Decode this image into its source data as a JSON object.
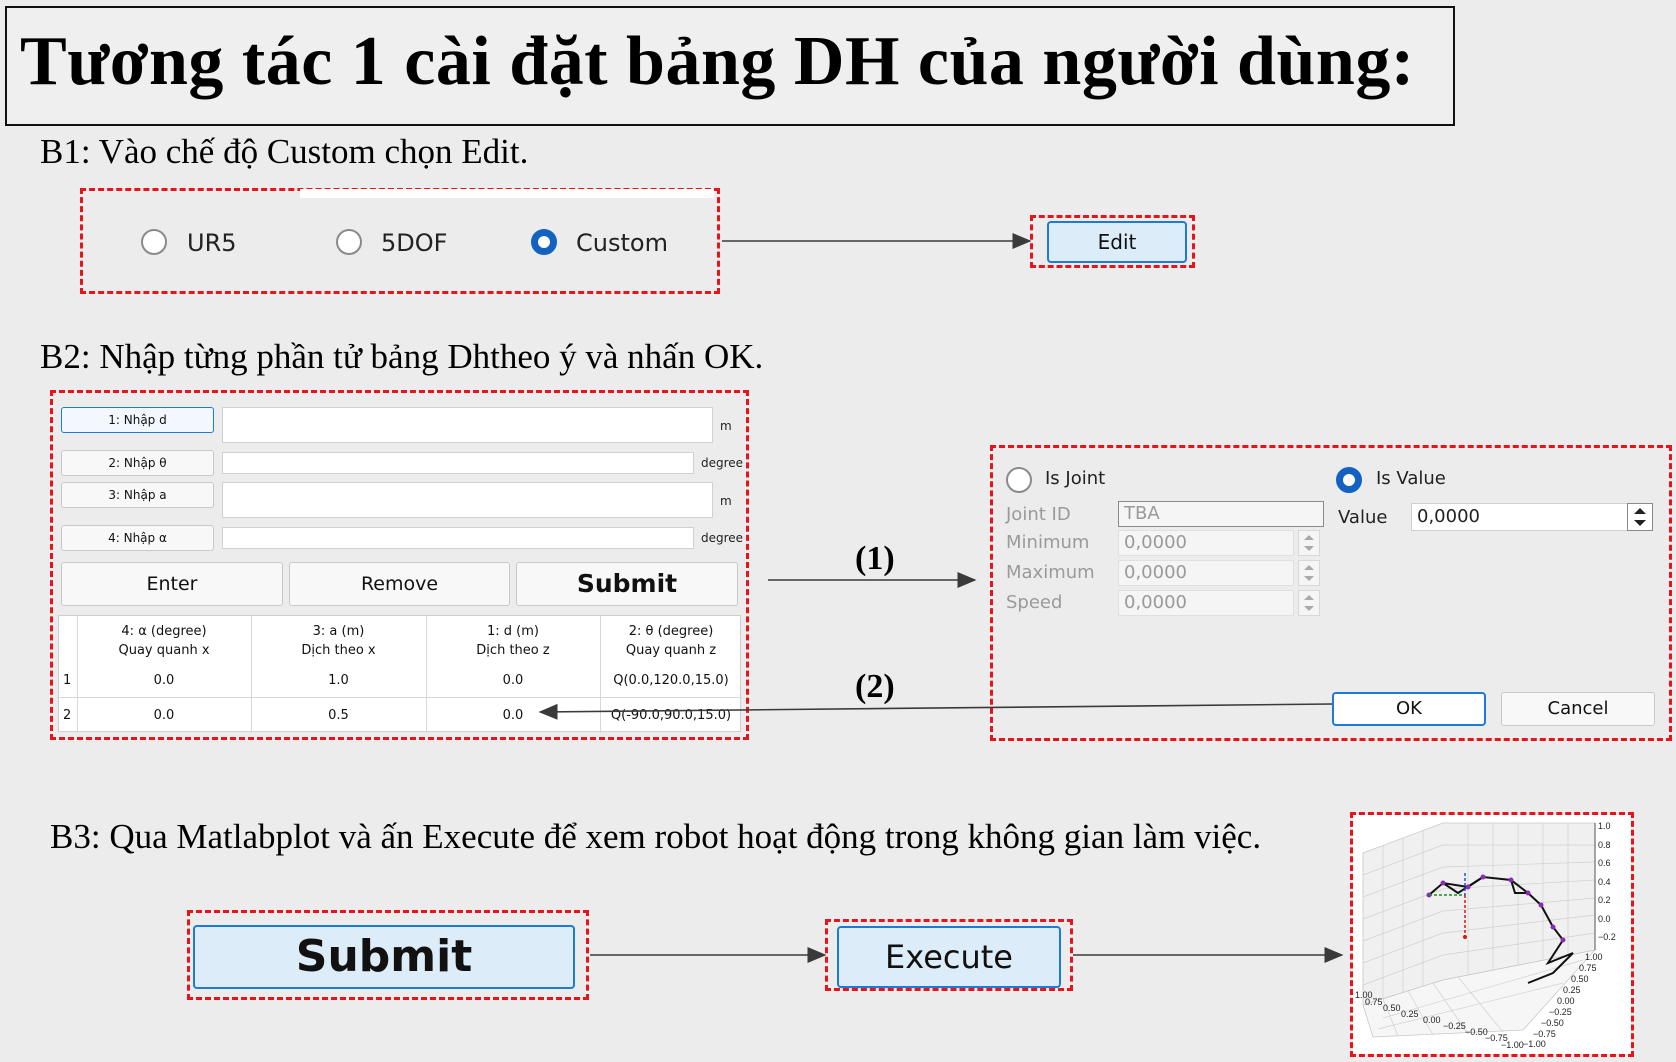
{
  "title": "Tương tác 1 cài đặt bảng DH của người dùng:",
  "steps": {
    "b1": "B1: Vào chế độ Custom chọn Edit.",
    "b2": "B2: Nhập từng phần tử bảng Dhtheo ý và nhấn OK.",
    "b3": "B3: Qua Matlabplot và ấn Execute để xem robot hoạt động trong không gian làm việc."
  },
  "mode_selector": {
    "options": [
      "UR5",
      "5DOF",
      "Custom"
    ],
    "selected": "Custom"
  },
  "edit_button": "Edit",
  "dh_form": {
    "fields": [
      {
        "label": "1: Nhập d",
        "unit": "m"
      },
      {
        "label": "2: Nhập θ",
        "unit": "degree"
      },
      {
        "label": "3: Nhập a",
        "unit": "m"
      },
      {
        "label": "4: Nhập α",
        "unit": "degree"
      }
    ],
    "buttons": {
      "enter": "Enter",
      "remove": "Remove",
      "submit": "Submit"
    }
  },
  "dh_table": {
    "headers": [
      {
        "line1": "4: α (degree)",
        "line2": "Quay quanh x"
      },
      {
        "line1": "3: a (m)",
        "line2": "Dịch theo x"
      },
      {
        "line1": "1: d (m)",
        "line2": "Dịch theo z"
      },
      {
        "line1": "2: θ (degree)",
        "line2": "Quay quanh z"
      }
    ],
    "rows": [
      {
        "index": "1",
        "cells": [
          "0.0",
          "1.0",
          "0.0",
          "Q(0.0,120.0,15.0)"
        ]
      },
      {
        "index": "2",
        "cells": [
          "0.0",
          "0.5",
          "0.0",
          "Q(-90.0,90.0,15.0)"
        ]
      }
    ]
  },
  "arrow_labels": {
    "one": "(1)",
    "two": "(2)"
  },
  "joint_dialog": {
    "is_joint": "Is Joint",
    "is_value": "Is Value",
    "selected": "Is Value",
    "joint_id_label": "Joint ID",
    "joint_id_value": "TBA",
    "minimum_label": "Minimum",
    "minimum_value": "0,0000",
    "maximum_label": "Maximum",
    "maximum_value": "0,0000",
    "speed_label": "Speed",
    "speed_value": "0,0000",
    "value_label": "Value",
    "value_value": "0,0000",
    "ok": "OK",
    "cancel": "Cancel"
  },
  "bottom_buttons": {
    "submit": "Submit",
    "execute": "Execute"
  },
  "plot3d": {
    "z_ticks": [
      "1.0",
      "0.8",
      "0.6",
      "0.4",
      "0.2",
      "0.0",
      "−0.2"
    ],
    "y_ticks": [
      "1.00",
      "0.75",
      "0.50",
      "0.25",
      "0.00",
      "−0.25",
      "−0.50",
      "−0.75",
      "−1.00"
    ],
    "x_ticks": [
      "1.00",
      "0.75",
      "0.50",
      "0.25",
      "0.00",
      "−0.25",
      "−0.50",
      "−0.75",
      "−1.00"
    ]
  }
}
